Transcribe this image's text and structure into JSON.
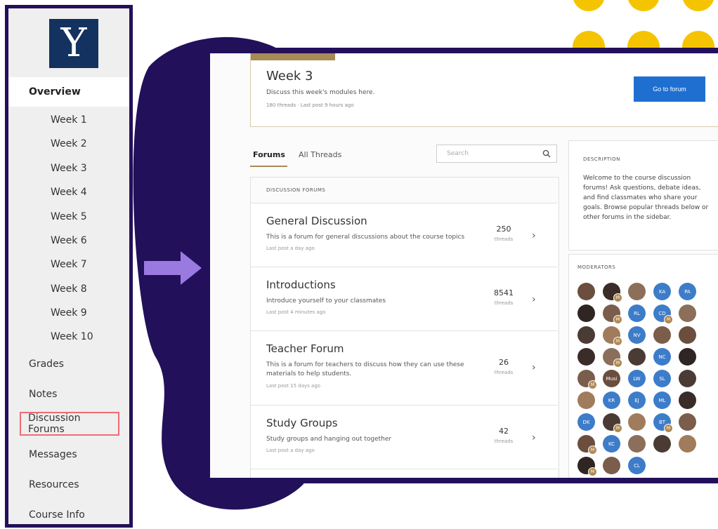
{
  "brand": {
    "logo_letter": "Y",
    "navy": "#14325f",
    "frame_purple": "#23105a",
    "accent_gold": "#a88a55",
    "dot_yellow": "#f5c400",
    "highlight_red": "#ef6b73"
  },
  "sidebar": {
    "items": [
      {
        "label": "Overview",
        "kind": "top",
        "active": true
      },
      {
        "label": "Week 1",
        "kind": "week"
      },
      {
        "label": "Week 2",
        "kind": "week"
      },
      {
        "label": "Week 3",
        "kind": "week"
      },
      {
        "label": "Week 4",
        "kind": "week"
      },
      {
        "label": "Week 5",
        "kind": "week"
      },
      {
        "label": "Week 6",
        "kind": "week"
      },
      {
        "label": "Week 7",
        "kind": "week"
      },
      {
        "label": "Week 8",
        "kind": "week"
      },
      {
        "label": "Week 9",
        "kind": "week"
      },
      {
        "label": "Week 10",
        "kind": "week"
      },
      {
        "label": "Grades",
        "kind": "top"
      },
      {
        "label": "Notes",
        "kind": "top"
      },
      {
        "label": "Discussion Forums",
        "kind": "top",
        "highlighted": true
      },
      {
        "label": "Messages",
        "kind": "top"
      },
      {
        "label": "Resources",
        "kind": "top"
      },
      {
        "label": "Course Info",
        "kind": "top"
      }
    ]
  },
  "week_card": {
    "title": "Week 3",
    "description": "Discuss this week's modules here.",
    "meta": "180 threads · Last post 9 hours ago",
    "button_label": "Go to forum"
  },
  "tabs": [
    {
      "label": "Forums",
      "active": true
    },
    {
      "label": "All Threads",
      "active": false
    }
  ],
  "search": {
    "placeholder": "Search",
    "value": ""
  },
  "forums": {
    "header": "DISCUSSION FORUMS",
    "items": [
      {
        "title": "General Discussion",
        "description": "This is a forum for general discussions about the course topics",
        "meta": "Last post a day ago",
        "count": "250",
        "count_label": "threads"
      },
      {
        "title": "Introductions",
        "description": "Introduce yourself to your classmates",
        "meta": "Last post 4 minutes ago",
        "count": "8541",
        "count_label": "threads"
      },
      {
        "title": "Teacher Forum",
        "description": "This is a forum for teachers to discuss how they can use these materials to help students.",
        "meta": "Last post 15 days ago",
        "count": "26",
        "count_label": "threads"
      },
      {
        "title": "Study Groups",
        "description": "Study groups and hanging out together",
        "meta": "Last post a day ago",
        "count": "42",
        "count_label": "threads"
      }
    ]
  },
  "description_box": {
    "label": "DESCRIPTION",
    "text": "Welcome to the course discussion forums! Ask questions, debate ideas, and find classmates who share your goals. Browse popular threads below or other forums in the sidebar."
  },
  "moderators": {
    "label": "MODERATORS",
    "avatars": [
      {
        "type": "photo"
      },
      {
        "type": "photo",
        "badge": "M"
      },
      {
        "type": "photo"
      },
      {
        "type": "initials",
        "text": "KA"
      },
      {
        "type": "initials",
        "text": "PA"
      },
      {
        "type": "photo"
      },
      {
        "type": "photo",
        "badge": "M"
      },
      {
        "type": "initials",
        "text": "RL"
      },
      {
        "type": "initials",
        "text": "CD",
        "badge": "M"
      },
      {
        "type": "photo"
      },
      {
        "type": "photo"
      },
      {
        "type": "photo",
        "badge": "M"
      },
      {
        "type": "initials",
        "text": "NV"
      },
      {
        "type": "photo"
      },
      {
        "type": "photo"
      },
      {
        "type": "photo"
      },
      {
        "type": "photo",
        "badge": "M"
      },
      {
        "type": "photo"
      },
      {
        "type": "initials",
        "text": "NC"
      },
      {
        "type": "photo"
      },
      {
        "type": "photo",
        "badge": "M"
      },
      {
        "type": "photo",
        "text": "Musi"
      },
      {
        "type": "initials",
        "text": "LW"
      },
      {
        "type": "initials",
        "text": "SL"
      },
      {
        "type": "photo"
      },
      {
        "type": "photo"
      },
      {
        "type": "initials",
        "text": "KR"
      },
      {
        "type": "initials",
        "text": "EJ"
      },
      {
        "type": "initials",
        "text": "ML"
      },
      {
        "type": "photo"
      },
      {
        "type": "initials",
        "text": "DK"
      },
      {
        "type": "photo",
        "badge": "M"
      },
      {
        "type": "photo"
      },
      {
        "type": "initials",
        "text": "BT",
        "badge": "M"
      },
      {
        "type": "photo"
      },
      {
        "type": "photo",
        "badge": "M"
      },
      {
        "type": "initials",
        "text": "KC"
      },
      {
        "type": "photo"
      },
      {
        "type": "photo"
      },
      {
        "type": "photo"
      },
      {
        "type": "photo",
        "badge": "M"
      },
      {
        "type": "photo"
      },
      {
        "type": "initials",
        "text": "CL"
      }
    ]
  }
}
